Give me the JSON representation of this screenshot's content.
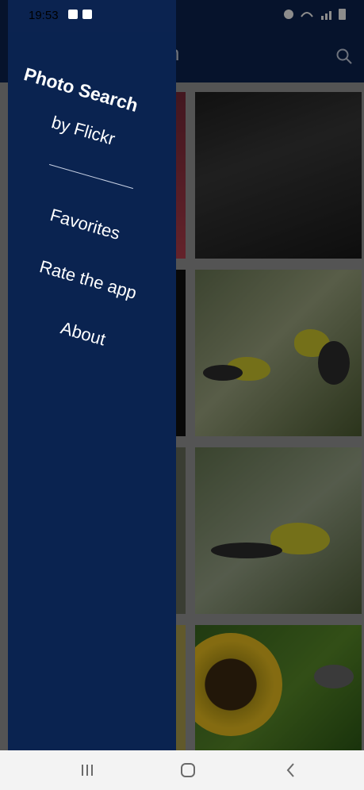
{
  "status_bar": {
    "time": "19:53"
  },
  "toolbar": {
    "title_fragment": "n"
  },
  "drawer": {
    "title": "Photo Search",
    "subtitle": "by Flickr",
    "items": [
      {
        "label": "Favorites"
      },
      {
        "label": "Rate the app"
      },
      {
        "label": "About"
      }
    ]
  },
  "navigation": {
    "menu_icon": "recent-apps-icon",
    "home_icon": "home-icon",
    "back_icon": "back-icon"
  },
  "colors": {
    "drawer_bg": "#0a2350",
    "toolbar_bg": "#0b2350",
    "navbar_bg": "#f3f3f3"
  }
}
